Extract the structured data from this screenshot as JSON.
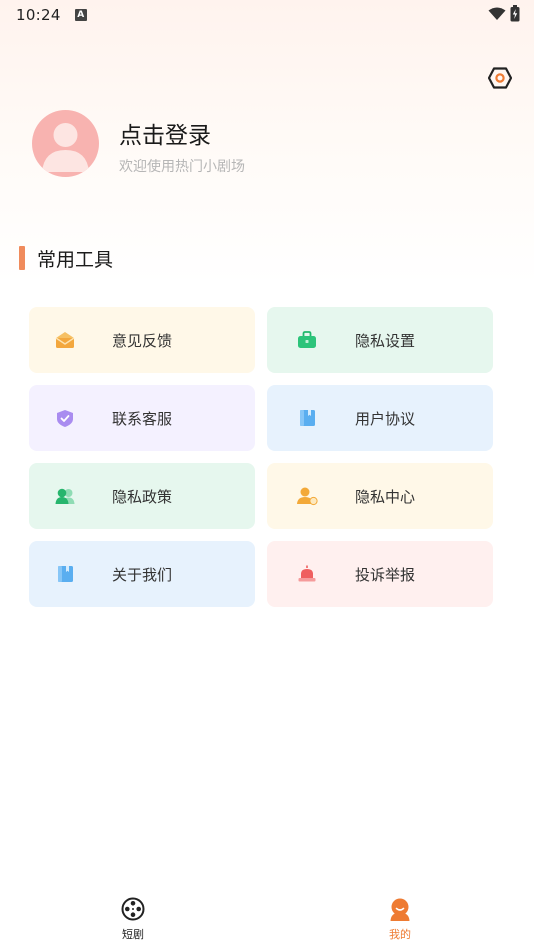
{
  "status_bar": {
    "time": "10:24",
    "notification_glyph": "A"
  },
  "profile": {
    "login_title": "点击登录",
    "login_subtitle": "欢迎使用热门小剧场"
  },
  "section": {
    "title": "常用工具"
  },
  "tools": [
    {
      "label": "意见反馈",
      "icon": "mail-icon",
      "bg": "#fff8e8"
    },
    {
      "label": "隐私设置",
      "icon": "briefcase-icon",
      "bg": "#e6f7ee"
    },
    {
      "label": "联系客服",
      "icon": "shield-icon",
      "bg": "#f4f1ff"
    },
    {
      "label": "用户协议",
      "icon": "book-icon",
      "bg": "#e7f2fd"
    },
    {
      "label": "隐私政策",
      "icon": "group-icon",
      "bg": "#e6f7ee"
    },
    {
      "label": "隐私中心",
      "icon": "user-icon",
      "bg": "#fff8e8"
    },
    {
      "label": "关于我们",
      "icon": "book-icon",
      "bg": "#e7f2fd"
    },
    {
      "label": "投诉举报",
      "icon": "alarm-icon",
      "bg": "#fff0ef"
    }
  ],
  "tabbar": {
    "tabs": [
      {
        "label": "短剧",
        "icon": "film-reel-icon",
        "color": "#222222"
      },
      {
        "label": "我的",
        "icon": "profile-icon",
        "color": "#ee7b33"
      }
    ]
  },
  "colors": {
    "accent": "#f08b5c",
    "active_tab": "#ee7b33"
  }
}
